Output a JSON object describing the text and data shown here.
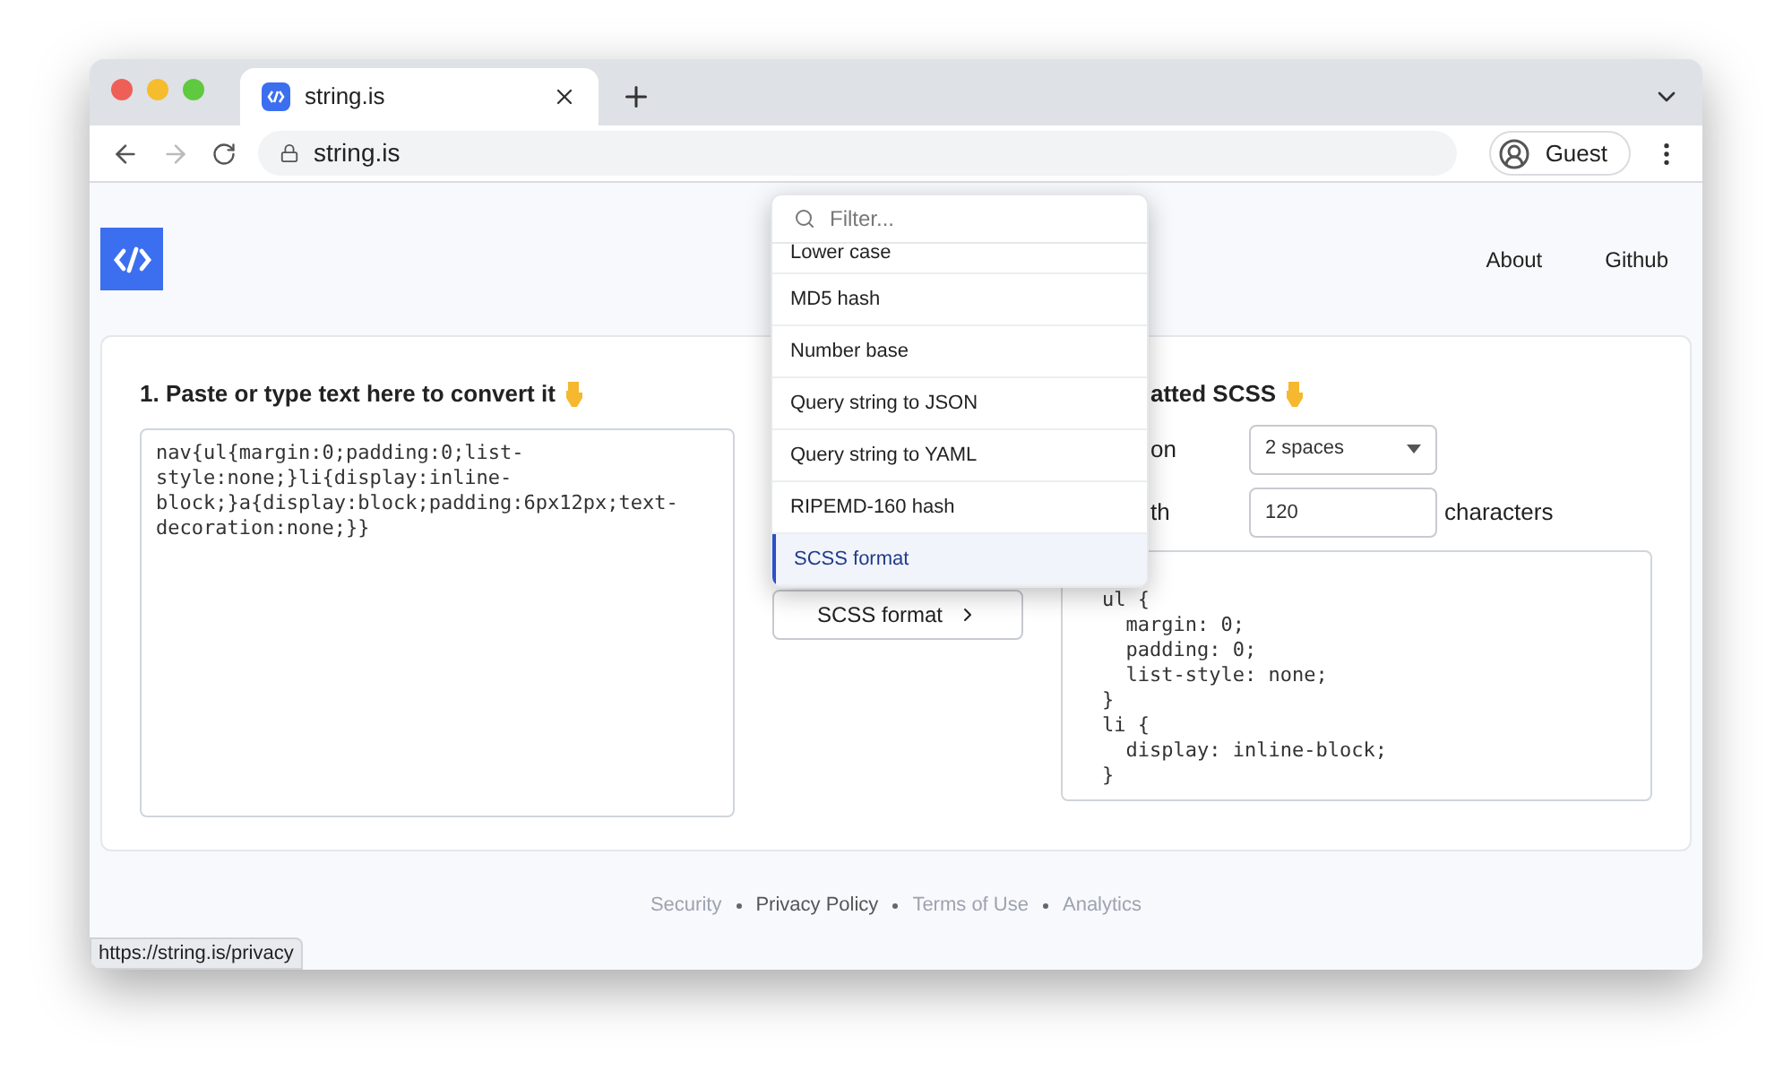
{
  "browser": {
    "tabs": [
      {
        "title": "string.is",
        "selected": true
      }
    ],
    "address": "string.is",
    "profile": "Guest"
  },
  "nav": [
    "About",
    "Github"
  ],
  "input": {
    "heading": "1. Paste or type text here to convert it",
    "value": "nav{ul{margin:0;padding:0;list-style:none;}li{display:inline-block;}a{display:block;padding:6px12px;text-decoration:none;}}"
  },
  "converter": {
    "filter_placeholder": "Filter...",
    "options": [
      {
        "label": "Lower case",
        "selected": false
      },
      {
        "label": "MD5 hash",
        "selected": false
      },
      {
        "label": "Number base",
        "selected": false
      },
      {
        "label": "Query string to JSON",
        "selected": false
      },
      {
        "label": "Query string to YAML",
        "selected": false
      },
      {
        "label": "RIPEMD-160 hash",
        "selected": false
      },
      {
        "label": "SCSS format",
        "selected": true
      }
    ],
    "button": "SCSS format"
  },
  "output": {
    "heading": "atted SCSS",
    "indent_label": "on",
    "indent_value": "2 spaces",
    "width_label": "th",
    "width_value": "120",
    "width_unit": "characters",
    "value": "ul {\n  margin: 0;\n  padding: 0;\n  list-style: none;\n}\nli {\n  display: inline-block;\n}"
  },
  "footer": [
    {
      "label": "Security",
      "hovered": false
    },
    {
      "label": "Privacy Policy",
      "hovered": true
    },
    {
      "label": "Terms of Use",
      "hovered": false
    },
    {
      "label": "Analytics",
      "hovered": false
    }
  ],
  "status_url": "https://string.is/privacy"
}
